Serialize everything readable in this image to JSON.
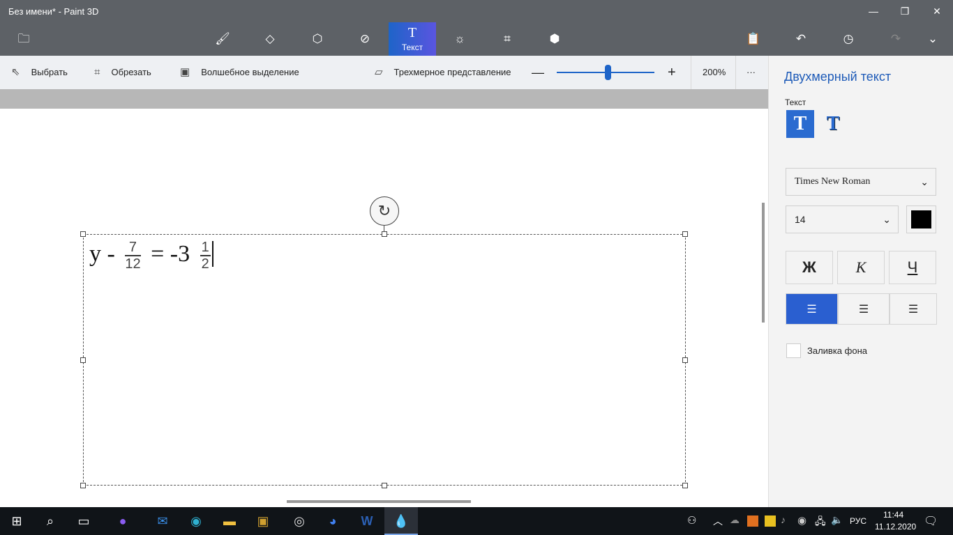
{
  "window": {
    "title": "Без имени* - Paint 3D",
    "minimize": "—",
    "maximize": "❐",
    "close": "✕"
  },
  "ribbon": {
    "active_label": "Текст",
    "active_glyph": "T"
  },
  "toolbar": {
    "select": "Выбрать",
    "crop": "Обрезать",
    "magic_select": "Волшебное выделение",
    "view3d": "Трехмерное представление",
    "zoom": "200%",
    "zoom_value_percent": 200,
    "more": "···"
  },
  "canvas": {
    "text_left": "y - ",
    "frac1_num": "7",
    "frac1_den": "12",
    "text_mid": " = -3 ",
    "frac2_num": "1",
    "frac2_den": "2"
  },
  "panel": {
    "title": "Двухмерный текст",
    "text_label": "Текст",
    "font": "Times New Roman",
    "size": "14",
    "color": "#000000",
    "bold": "Ж",
    "italic": "К",
    "underline": "Ч",
    "fill_label": "Заливка фона"
  },
  "taskbar": {
    "lang": "РУС",
    "time": "11:44",
    "date": "11.12.2020"
  }
}
